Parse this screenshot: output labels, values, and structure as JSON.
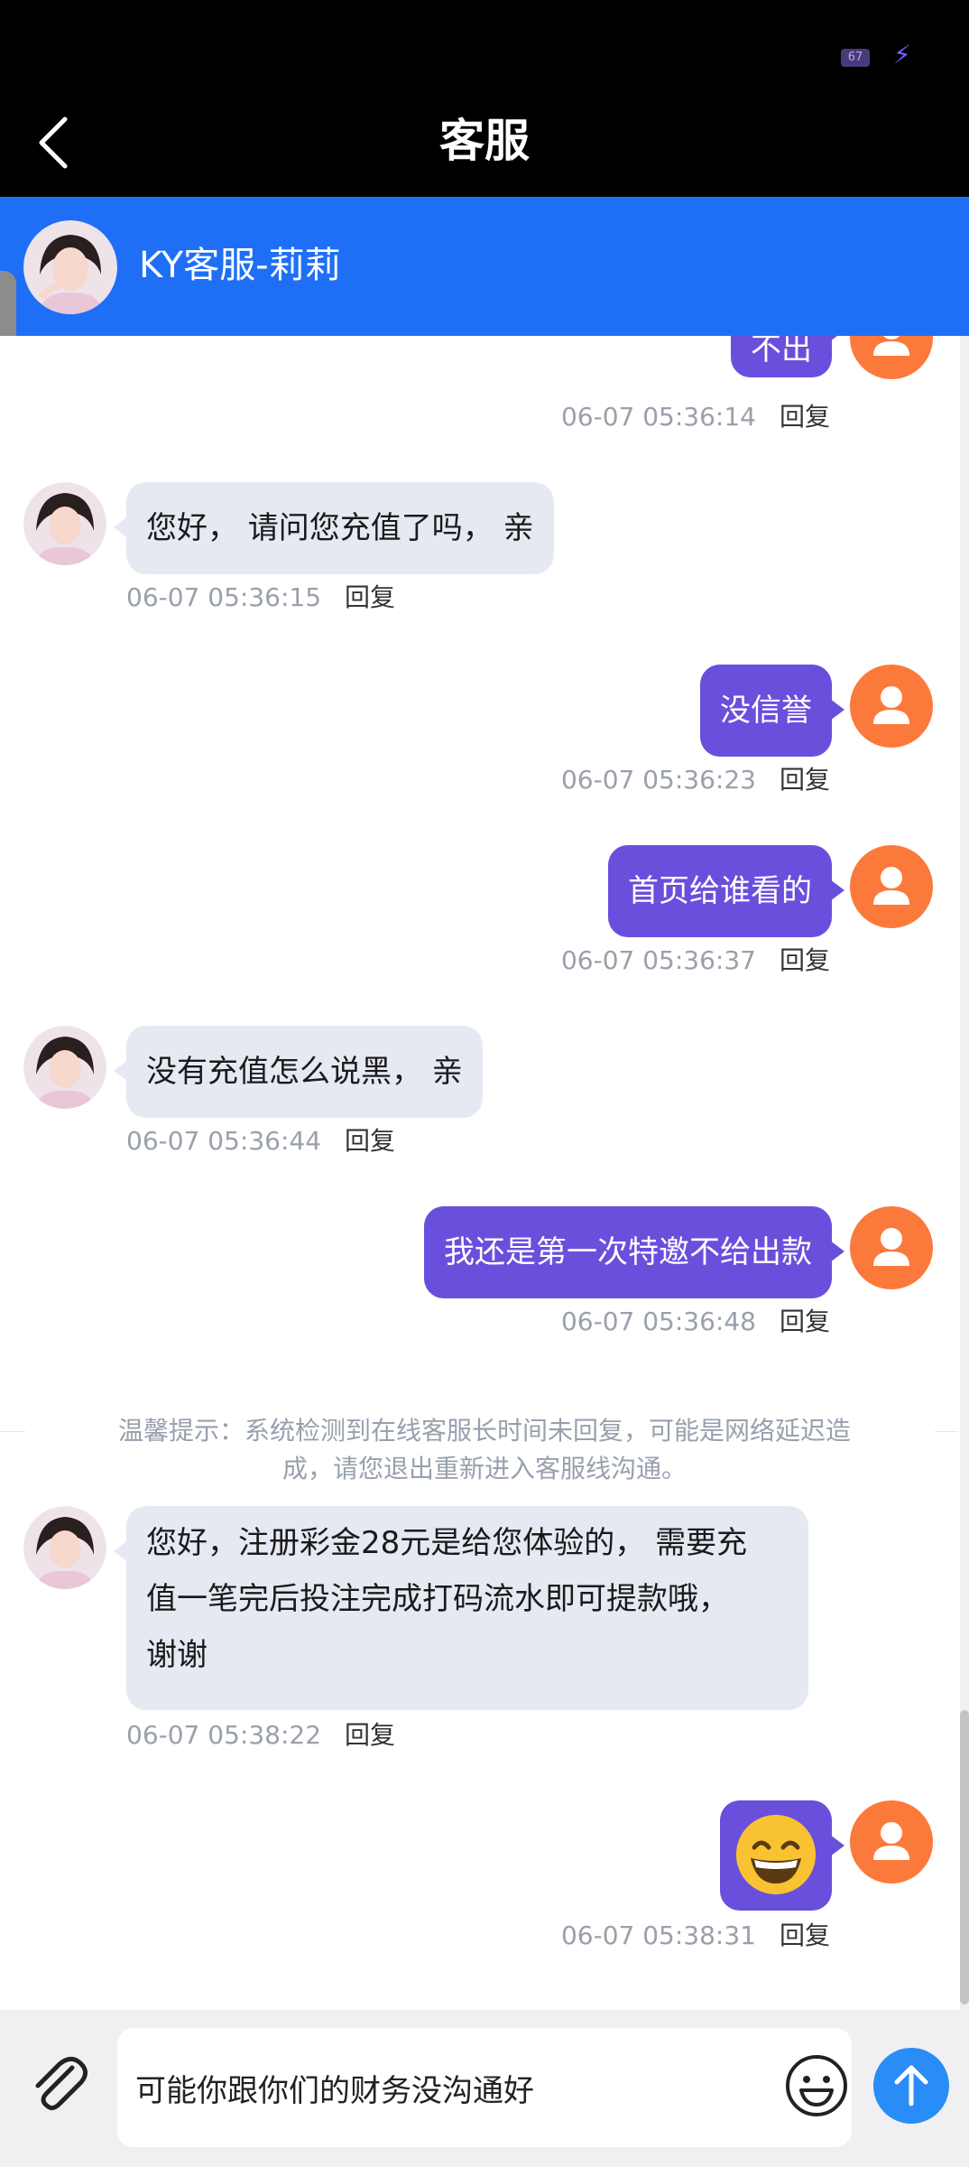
{
  "status_bar": {
    "battery": "67"
  },
  "header": {
    "title": "客服"
  },
  "agent": {
    "name": "KY客服-莉莉"
  },
  "messages": [
    {
      "from": "user",
      "text": "不出",
      "time": "06-07 05:36:14",
      "reply": "回复"
    },
    {
      "from": "agent",
      "text": "您好， 请问您充值了吗， 亲",
      "time": "06-07 05:36:15",
      "reply": "回复"
    },
    {
      "from": "user",
      "text": "没信誉",
      "time": "06-07 05:36:23",
      "reply": "回复"
    },
    {
      "from": "user",
      "text": "首页给谁看的",
      "time": "06-07 05:36:37",
      "reply": "回复"
    },
    {
      "from": "agent",
      "text": "没有充值怎么说黑， 亲",
      "time": "06-07 05:36:44",
      "reply": "回复"
    },
    {
      "from": "user",
      "text": "我还是第一次特邀不给出款",
      "time": "06-07 05:36:48",
      "reply": "回复"
    },
    {
      "from": "agent",
      "text_lines": [
        "您好，注册彩金28元是给您体验的， 需要充",
        "值一笔完后投注完成打码流水即可提款哦，",
        "谢谢"
      ],
      "time": "06-07 05:38:22",
      "reply": "回复"
    },
    {
      "from": "user",
      "emoji": "grinning-face",
      "time": "06-07 05:38:31",
      "reply": "回复"
    }
  ],
  "notice": {
    "lines": [
      "温馨提示：系统检测到在线客服长时间未回复，可能是网络延迟造",
      "成，请您退出重新进入客服线沟通。"
    ]
  },
  "composer": {
    "input_value": "可能你跟你们的财务没沟通好"
  },
  "colors": {
    "header_bg": "#000000",
    "agent_bar": "#1f6ff6",
    "user_bubble": "#6a4fdc",
    "agent_bubble": "#e6e9f2",
    "user_avatar": "#fb7a3b",
    "send_button": "#2a8cf6"
  }
}
